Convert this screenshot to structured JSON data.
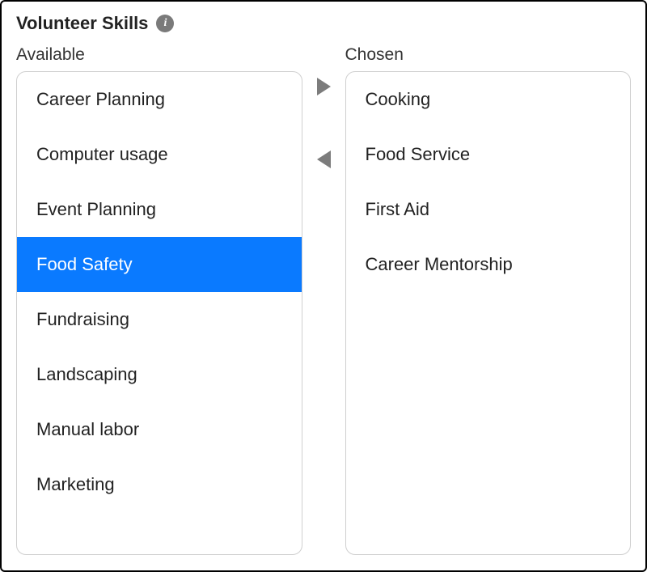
{
  "title": "Volunteer Skills",
  "info_icon_glyph": "i",
  "available": {
    "label": "Available",
    "items": [
      {
        "label": "Career Planning",
        "selected": false
      },
      {
        "label": "Computer usage",
        "selected": false
      },
      {
        "label": "Event Planning",
        "selected": false
      },
      {
        "label": "Food Safety",
        "selected": true
      },
      {
        "label": "Fundraising",
        "selected": false
      },
      {
        "label": "Landscaping",
        "selected": false
      },
      {
        "label": "Manual labor",
        "selected": false
      },
      {
        "label": "Marketing",
        "selected": false
      }
    ]
  },
  "chosen": {
    "label": "Chosen",
    "items": [
      {
        "label": "Cooking",
        "selected": false
      },
      {
        "label": "Food Service",
        "selected": false
      },
      {
        "label": "First Aid",
        "selected": false
      },
      {
        "label": "Career Mentorship",
        "selected": false
      }
    ]
  }
}
